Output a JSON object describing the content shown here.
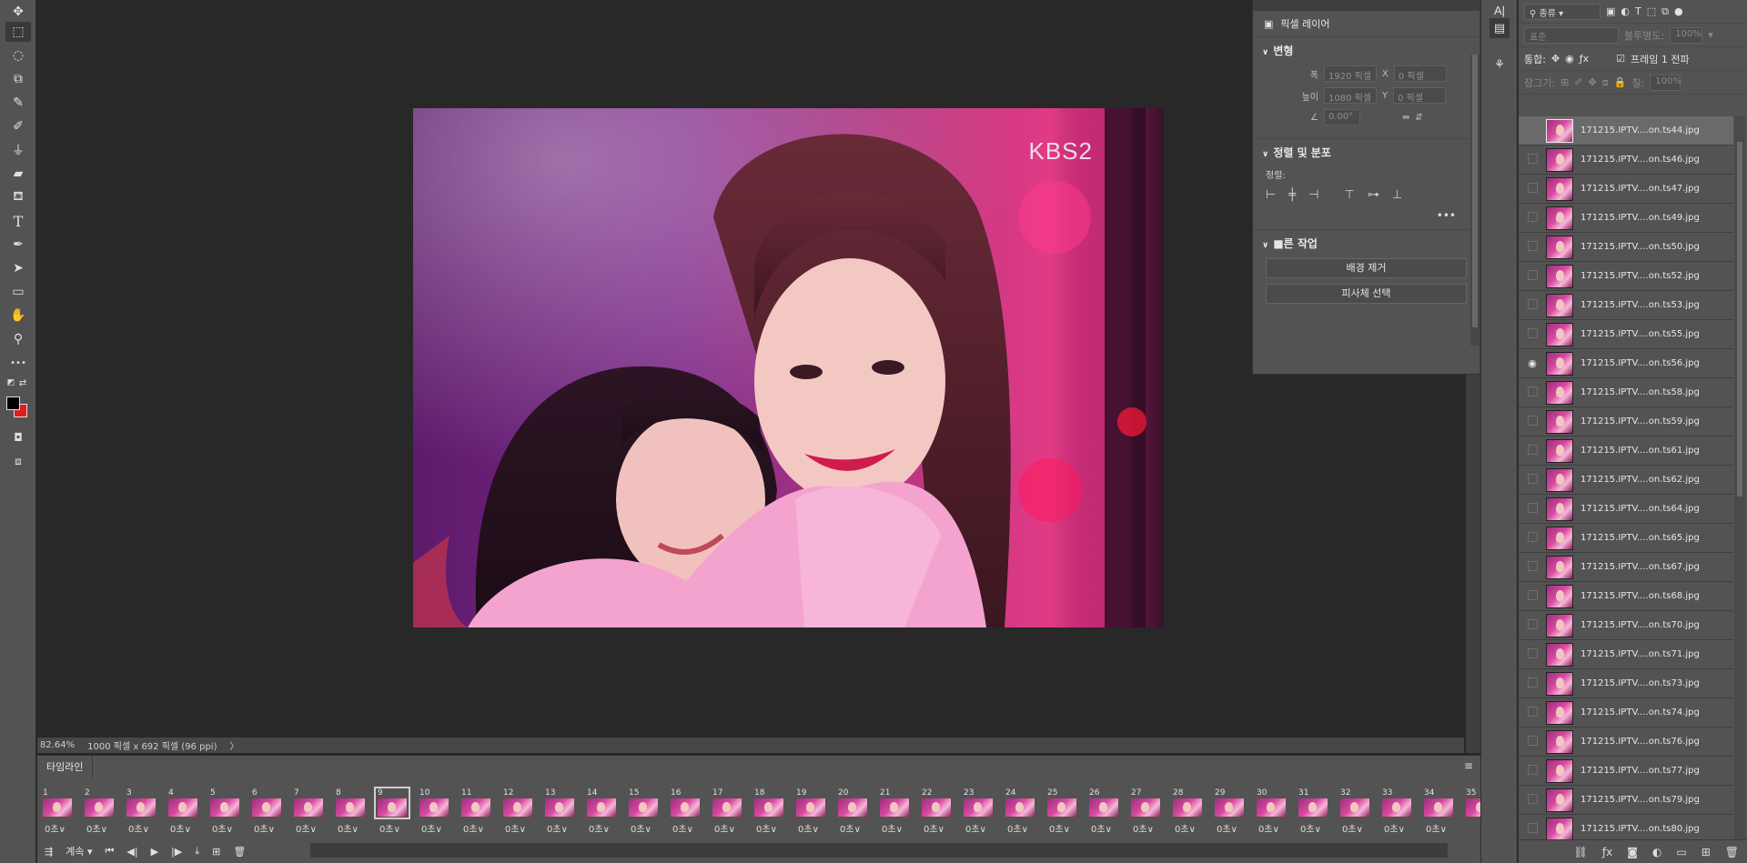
{
  "toolbar": {
    "tools": [
      "move-icon",
      "marquee-icon",
      "lasso-icon",
      "object-select-icon",
      "eyedropper-icon",
      "brush-icon",
      "stamp-icon",
      "eraser-icon",
      "paint-bucket-icon",
      "type-icon",
      "pen-icon",
      "path-select-icon",
      "rectangle-icon",
      "hand-icon",
      "zoom-icon",
      "more-icon"
    ],
    "type_glyph": "T",
    "more_glyph": "•••",
    "foreground_color": "#000000",
    "background_color": "#e01e1e"
  },
  "document": {
    "watermark": "KBS2"
  },
  "statusbar": {
    "zoom": "82.64%",
    "doc_info": "1000 픽셀 x 692 픽셀 (96 ppi)",
    "arrow": "〉"
  },
  "timeline": {
    "tab_label": "타임라인",
    "loop_label": "계속",
    "frames": [
      {
        "num": "1",
        "delay": "0초"
      },
      {
        "num": "2",
        "delay": "0초"
      },
      {
        "num": "3",
        "delay": "0초"
      },
      {
        "num": "4",
        "delay": "0초"
      },
      {
        "num": "5",
        "delay": "0초"
      },
      {
        "num": "6",
        "delay": "0초"
      },
      {
        "num": "7",
        "delay": "0초"
      },
      {
        "num": "8",
        "delay": "0초"
      },
      {
        "num": "9",
        "delay": "0초",
        "selected": true
      },
      {
        "num": "10",
        "delay": "0초"
      },
      {
        "num": "11",
        "delay": "0초"
      },
      {
        "num": "12",
        "delay": "0초"
      },
      {
        "num": "13",
        "delay": "0초"
      },
      {
        "num": "14",
        "delay": "0초"
      },
      {
        "num": "15",
        "delay": "0초"
      },
      {
        "num": "16",
        "delay": "0초"
      },
      {
        "num": "17",
        "delay": "0초"
      },
      {
        "num": "18",
        "delay": "0초"
      },
      {
        "num": "19",
        "delay": "0초"
      },
      {
        "num": "20",
        "delay": "0초"
      },
      {
        "num": "21",
        "delay": "0초"
      },
      {
        "num": "22",
        "delay": "0초"
      },
      {
        "num": "23",
        "delay": "0초"
      },
      {
        "num": "24",
        "delay": "0초"
      },
      {
        "num": "25",
        "delay": "0초"
      },
      {
        "num": "26",
        "delay": "0초"
      },
      {
        "num": "27",
        "delay": "0초"
      },
      {
        "num": "28",
        "delay": "0초"
      },
      {
        "num": "29",
        "delay": "0초"
      },
      {
        "num": "30",
        "delay": "0초"
      },
      {
        "num": "31",
        "delay": "0초"
      },
      {
        "num": "32",
        "delay": "0초"
      },
      {
        "num": "33",
        "delay": "0초"
      },
      {
        "num": "34",
        "delay": "0초"
      },
      {
        "num": "35",
        "delay": ""
      }
    ]
  },
  "properties": {
    "layer_type": "픽셀 레이어",
    "transform_title": "변형",
    "width_label": "폭",
    "width_value": "1920 픽셀",
    "height_label": "높이",
    "height_value": "1080 픽셀",
    "x_label": "X",
    "x_value": "0 픽셀",
    "y_label": "Y",
    "y_value": "0 픽셀",
    "angle_value": "0.00°",
    "align_title": "정렬 및 분포",
    "align_label": "정렬:",
    "quick_title": "빠른 작업",
    "quick_title_shown": "■른 작업",
    "btn_remove_bg": "배경 제거",
    "btn_select_subject": "피사체 선택"
  },
  "layers": {
    "kind_label": "종류",
    "blend_mode": "표준",
    "opacity_label": "불투명도:",
    "opacity_value": "100%",
    "unify_label": "통합:",
    "frame_propagate_label": "프레임 1 전파",
    "lock_label": "잠그기:",
    "fill_label": "칠:",
    "fill_value": "100%",
    "items": [
      {
        "name": "171215.IPTV....on.ts44.jpg",
        "selected": true,
        "visible": false
      },
      {
        "name": "171215.IPTV....on.ts46.jpg",
        "visible": false
      },
      {
        "name": "171215.IPTV....on.ts47.jpg",
        "visible": false
      },
      {
        "name": "171215.IPTV....on.ts49.jpg",
        "visible": false
      },
      {
        "name": "171215.IPTV....on.ts50.jpg",
        "visible": false
      },
      {
        "name": "171215.IPTV....on.ts52.jpg",
        "visible": false
      },
      {
        "name": "171215.IPTV....on.ts53.jpg",
        "visible": false
      },
      {
        "name": "171215.IPTV....on.ts55.jpg",
        "visible": false
      },
      {
        "name": "171215.IPTV....on.ts56.jpg",
        "visible": true
      },
      {
        "name": "171215.IPTV....on.ts58.jpg",
        "visible": false
      },
      {
        "name": "171215.IPTV....on.ts59.jpg",
        "visible": false
      },
      {
        "name": "171215.IPTV....on.ts61.jpg",
        "visible": false
      },
      {
        "name": "171215.IPTV....on.ts62.jpg",
        "visible": false
      },
      {
        "name": "171215.IPTV....on.ts64.jpg",
        "visible": false
      },
      {
        "name": "171215.IPTV....on.ts65.jpg",
        "visible": false
      },
      {
        "name": "171215.IPTV....on.ts67.jpg",
        "visible": false
      },
      {
        "name": "171215.IPTV....on.ts68.jpg",
        "visible": false
      },
      {
        "name": "171215.IPTV....on.ts70.jpg",
        "visible": false
      },
      {
        "name": "171215.IPTV....on.ts71.jpg",
        "visible": false
      },
      {
        "name": "171215.IPTV....on.ts73.jpg",
        "visible": false
      },
      {
        "name": "171215.IPTV....on.ts74.jpg",
        "visible": false
      },
      {
        "name": "171215.IPTV....on.ts76.jpg",
        "visible": false
      },
      {
        "name": "171215.IPTV....on.ts77.jpg",
        "visible": false
      },
      {
        "name": "171215.IPTV....on.ts79.jpg",
        "visible": false
      },
      {
        "name": "171215.IPTV....on.ts80.jpg",
        "visible": false
      }
    ]
  }
}
